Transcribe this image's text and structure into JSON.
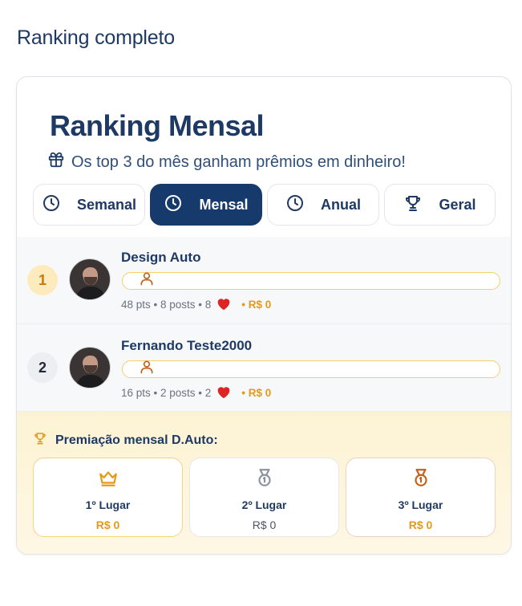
{
  "page": {
    "heading": "Ranking completo"
  },
  "card": {
    "title": "Ranking Mensal",
    "subtitle": "Os top 3 do mês ganham prêmios em dinheiro!",
    "subtitle_icon": "gift-icon"
  },
  "tabs": [
    {
      "label": "Semanal",
      "icon": "clock-icon",
      "active": false
    },
    {
      "label": "Mensal",
      "icon": "clock-icon",
      "active": true
    },
    {
      "label": "Anual",
      "icon": "clock-icon",
      "active": false
    },
    {
      "label": "Geral",
      "icon": "trophy-icon",
      "active": false
    }
  ],
  "ranking": [
    {
      "position": "1",
      "name": "Design Auto",
      "stats": "48 pts • 8 posts • 8",
      "prize": "• R$ 0",
      "highlight": true
    },
    {
      "position": "2",
      "name": "Fernando Teste2000",
      "stats": "16 pts • 2 posts • 2",
      "prize": "• R$ 0",
      "highlight": false
    }
  ],
  "prizes": {
    "title": "Premiação mensal D.Auto:",
    "items": [
      {
        "place": "1º Lugar",
        "amount": "R$ 0",
        "icon": "crown-icon"
      },
      {
        "place": "2º Lugar",
        "amount": "R$ 0",
        "icon": "medal-icon"
      },
      {
        "place": "3º Lugar",
        "amount": "R$ 0",
        "icon": "medal-icon"
      }
    ]
  },
  "colors": {
    "primary": "#163a6b",
    "accent": "#e39a18",
    "gold": "#f4cf6b",
    "heart": "#dc2626"
  }
}
